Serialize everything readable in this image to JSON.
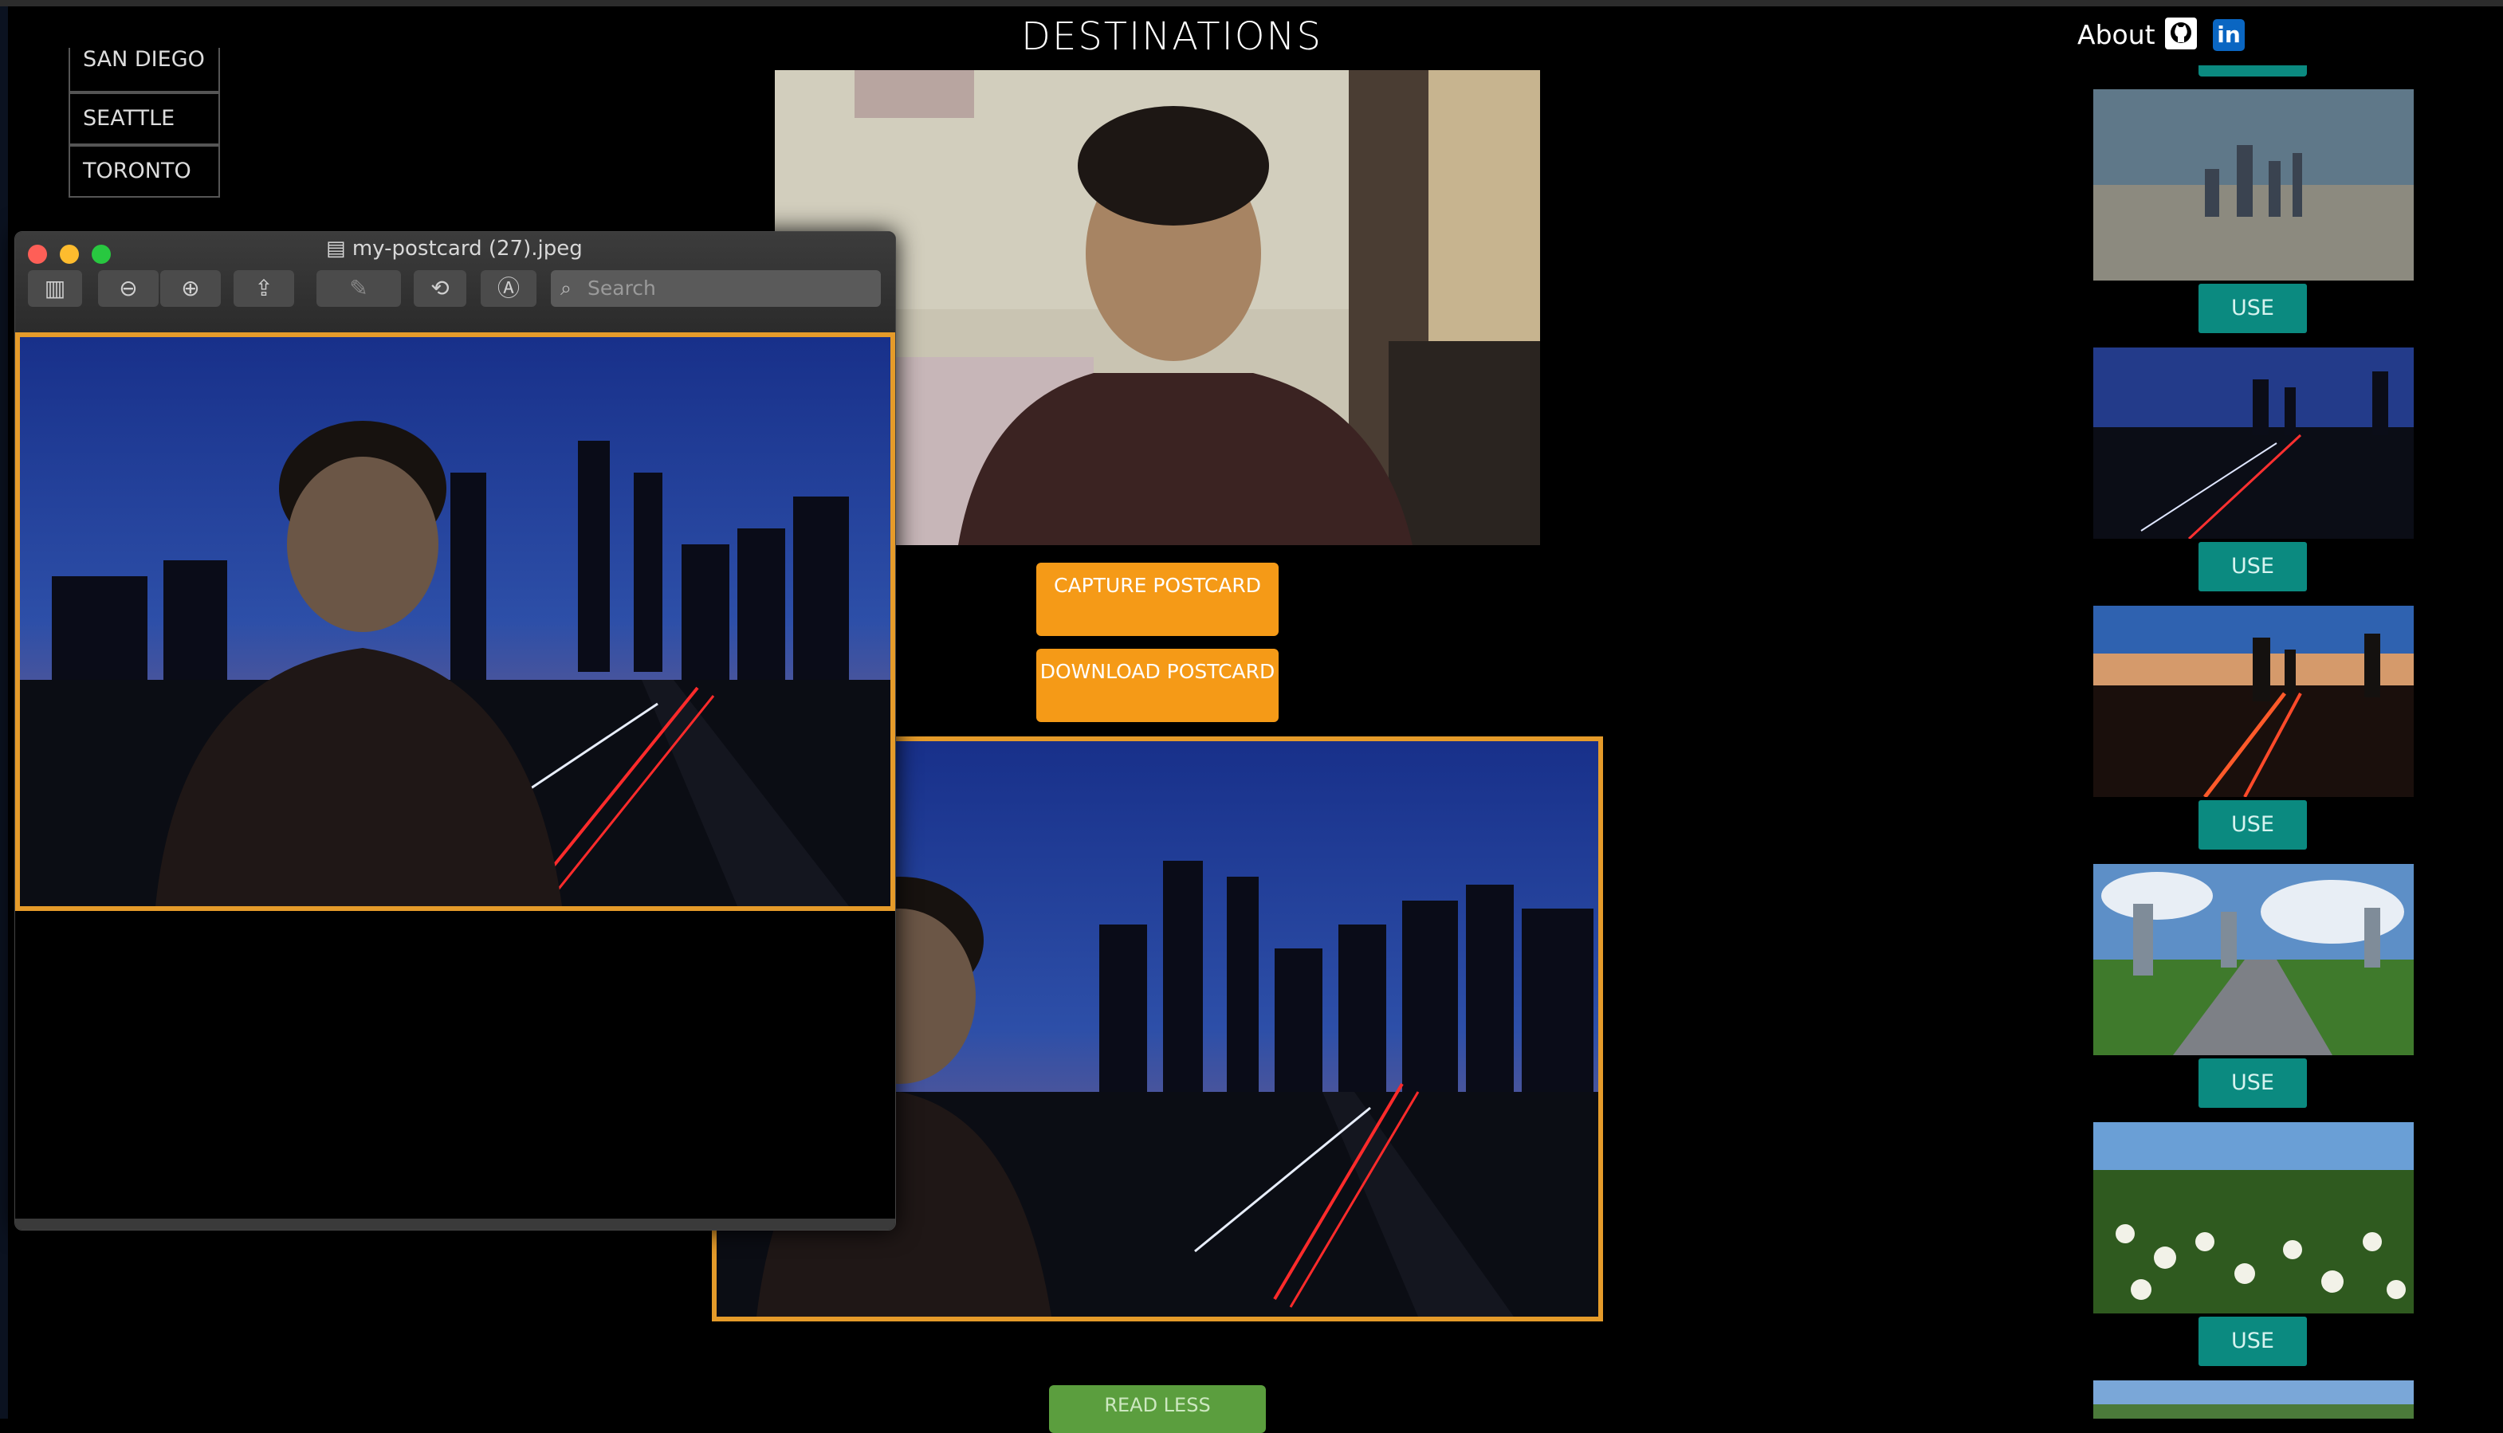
{
  "header": {
    "title": "DESTINATIONS",
    "about_label": "About"
  },
  "icons": {
    "github": "github-icon",
    "linkedin": "linkedin-icon",
    "search": "search-icon"
  },
  "cities": [
    "SAN DIEGO",
    "SEATTLE",
    "TORONTO"
  ],
  "buttons": {
    "capture": "CAPTURE POSTCARD",
    "download": "DOWNLOAD POSTCARD",
    "read_less": "READ LESS"
  },
  "gallery": {
    "use_label": "USE",
    "items": [
      "city-skyline-aerial",
      "highway-night",
      "highway-sunset",
      "highway-day",
      "daffodils-park",
      "park"
    ]
  },
  "preview_window": {
    "filename": "my-postcard (27).jpeg",
    "search_placeholder": "Search"
  },
  "colors": {
    "accent": "#f59a17",
    "use": "#0b8a80",
    "frame": "#e59b2a",
    "read_less": "#5b9e3e"
  }
}
